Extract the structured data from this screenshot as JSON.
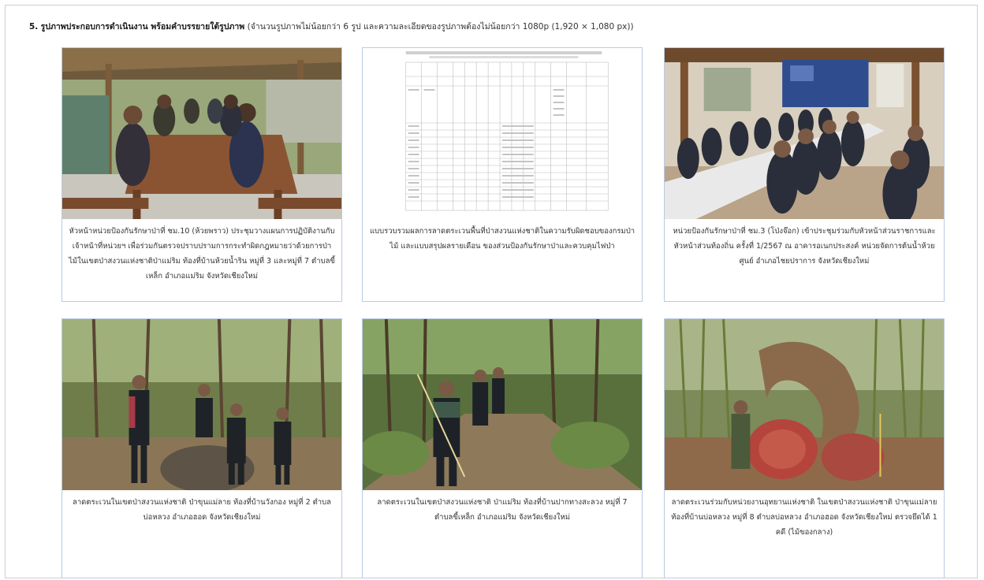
{
  "section": {
    "number": "5.",
    "title": "รูปภาพประกอบการดำเนินงาน พร้อมคำบรรยายใต้รูปภาพ",
    "note": "(จำนวนรูปภาพไม่น้อยกว่า 6 รูป และความละเอียดของรูปภาพต้องไม่น้อยกว่า 1080p (1,920 × 1,080 px))"
  },
  "photos": [
    {
      "icon": "meeting-outdoor-photo",
      "caption": "หัวหน้าหน่วยป้องกันรักษาป่าที่ ชม.10 (ห้วยพราว) ประชุมวางแผนการปฏิบัติงานกับเจ้าหน้าที่หน่วยฯ เพื่อร่วมกันตรวจปราบปรามการกระทำผิดกฎหมายว่าด้วยการป่าไม้ในเขตป่าสงวนแห่งชาติป่าแม่ริม ท้องที่บ้านห้วยน้ำริน หมู่ที่ 3 และหมู่ที่ 7 ตำบลขี้เหล็ก อำเภอแม่ริม จังหวัดเชียงใหม่"
    },
    {
      "icon": "document-table-photo",
      "caption": "แบบรวบรวมผลการลาดตระเวนพื้นที่ป่าสงวนแห่งชาติในความรับผิดชอบของกรมป่าไม้ และแบบสรุปผลรายเดือน ของส่วนป้องกันรักษาป่าและควบคุมไฟป่า"
    },
    {
      "icon": "meeting-room-photo",
      "caption": "หน่วยป้องกันรักษาป่าที่ ชม.3 (โป่งจ๊อก) เข้าประชุมร่วมกับหัวหน้าส่วนราชการและหัวหน้าส่วนท้องถิ่น ครั้งที่ 1/2567 ณ อาคารอเนกประสงค์ หน่วยจัดการต้นน้ำห้วยศูนย์ อำเภอไชยปราการ จังหวัดเชียงใหม่"
    },
    {
      "icon": "forest-patrol-photo",
      "caption": "ลาดตระเวนในเขตป่าสงวนแห่งชาติ ป่าขุนแม่ลาย ท้องที่บ้านวังกอง หมู่ที่ 2 ตำบลบ่อหลวง อำเภอฮอด จังหวัดเชียงใหม่"
    },
    {
      "icon": "forest-trail-photo",
      "caption": "ลาดตระเวนในเขตป่าสงวนแห่งชาติ ป่าแม่ริม ท้องที่บ้านปากทางสะลวง หมู่ที่ 7 ตำบลขี้เหล็ก อำเภอแม่ริม จังหวัดเชียงใหม่"
    },
    {
      "icon": "felled-tree-photo",
      "caption": "ลาดตระเวนร่วมกับหน่วยงานอุทยานแห่งชาติ ในเขตป่าสงวนแห่งชาติ ป่าขุนแม่ลาย ท้องที่บ้านบ่อหลวง หมู่ที่ 8 ตำบลบ่อหลวง อำเภอฮอด จังหวัดเชียงใหม่ ตรวจยึดได้ 1 คดี (ไม้ของกลาง)"
    }
  ]
}
